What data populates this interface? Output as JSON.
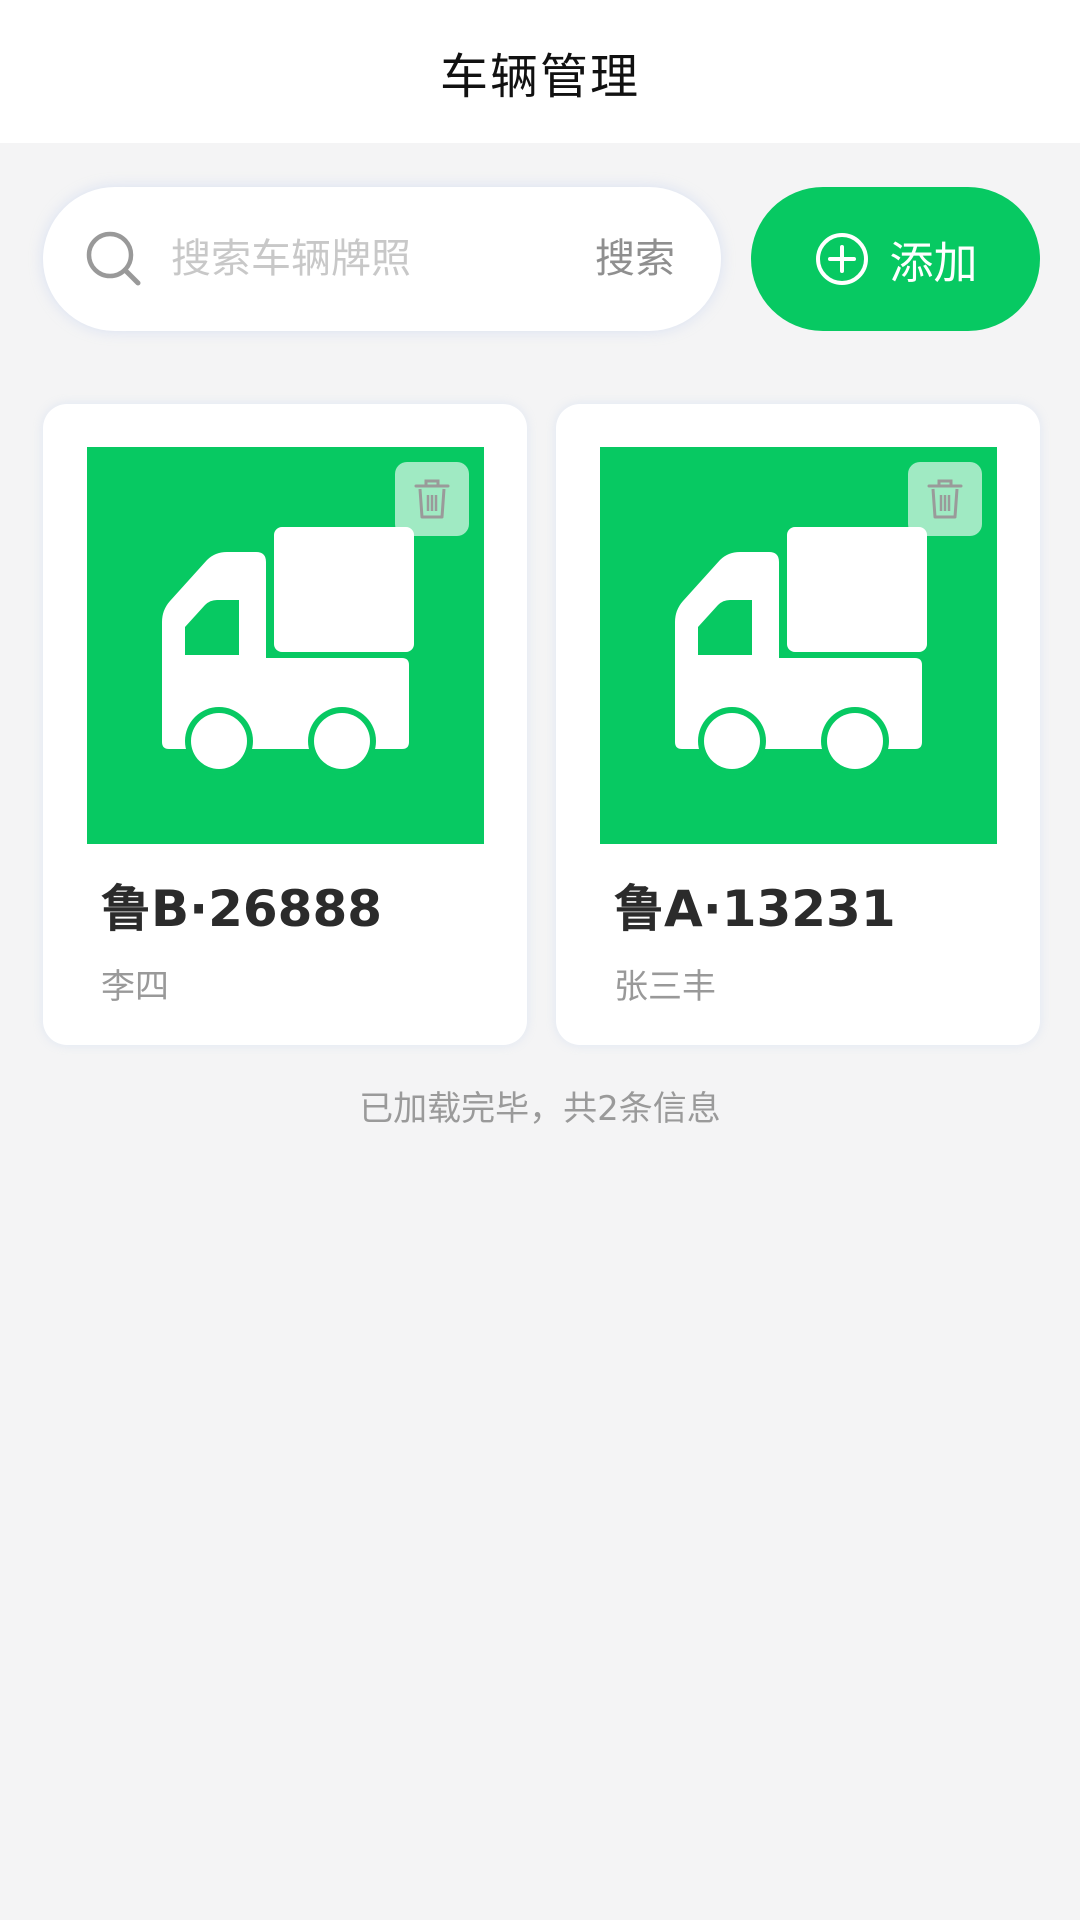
{
  "header": {
    "title": "车辆管理"
  },
  "search": {
    "placeholder": "搜索车辆牌照",
    "value": "",
    "button_label": "搜索"
  },
  "add_button": {
    "label": "添加"
  },
  "vehicles": [
    {
      "plate": "鲁B·26888",
      "owner": "李四"
    },
    {
      "plate": "鲁A·13231",
      "owner": "张三丰"
    }
  ],
  "footer": {
    "status": "已加载完毕，共2条信息"
  },
  "colors": {
    "accent": "#07c962",
    "background": "#f4f4f5",
    "card": "#ffffff"
  },
  "icons": {
    "search": "search-icon",
    "add": "plus-circle-icon",
    "vehicle": "truck-icon",
    "delete": "trash-icon"
  }
}
